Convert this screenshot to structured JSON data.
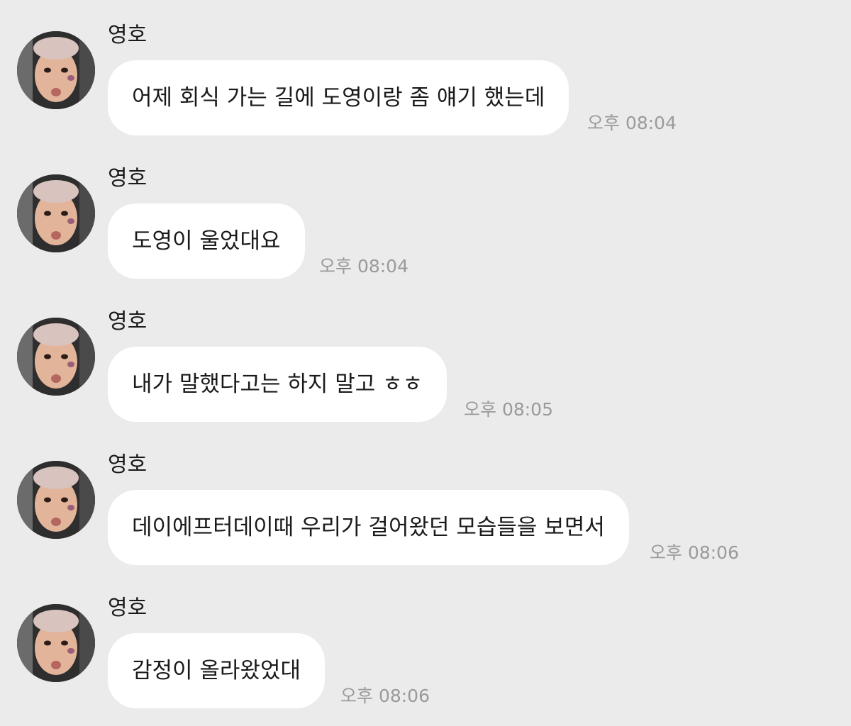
{
  "conversation": {
    "messages": [
      {
        "sender": "영호",
        "avatar": "profile-photo",
        "text": "어제 회식 가는 길에 도영이랑 좀 얘기 했는데",
        "time": "오후 08:04"
      },
      {
        "sender": "영호",
        "avatar": "profile-photo",
        "text": "도영이 울었대요",
        "time": "오후 08:04"
      },
      {
        "sender": "영호",
        "avatar": "profile-photo",
        "text": "내가 말했다고는 하지 말고 ㅎㅎ",
        "time": "오후 08:05"
      },
      {
        "sender": "영호",
        "avatar": "profile-photo",
        "text": "데이에프터데이때 우리가 걸어왔던 모습들을 보면서",
        "time": "오후 08:06"
      },
      {
        "sender": "영호",
        "avatar": "profile-photo",
        "text": "감정이 올라왔었대",
        "time": "오후 08:06"
      }
    ]
  },
  "colors": {
    "background": "#ebebeb",
    "bubble": "#ffffff",
    "timestamp": "#9a9a9a",
    "text": "#1a1a1a"
  }
}
